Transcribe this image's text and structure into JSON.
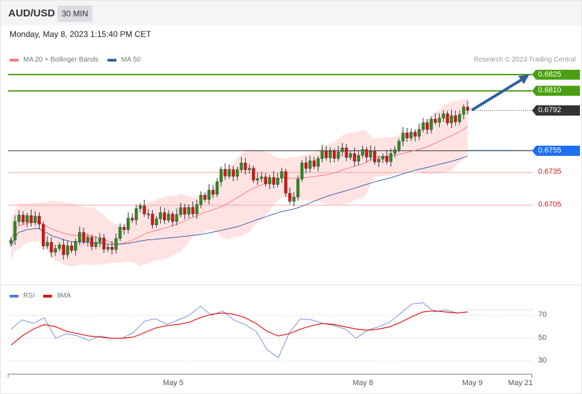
{
  "header": {
    "pair": "AUD/USD",
    "timeframe": "30 MIN",
    "datetime": "Monday, May 8, 2023 1:15:40 PM CET"
  },
  "legend": {
    "ma20": "MA 20 + Bollinger Bands",
    "ma50": "MA 50",
    "rsi": "RSI",
    "ma9": "9MA"
  },
  "credit": "Research © 2023 Trading Central",
  "colors": {
    "up": "#2e8b1e",
    "down": "#e01010",
    "ma20": "#ff7b7b",
    "ma50": "#3a5ea8",
    "band": "#ffe3e3",
    "target": "#4aa010",
    "pivot": "#1e6ef0",
    "current": "#333333",
    "support": "#e01010",
    "arrow": "#2f5f9e",
    "rsi": "#5577dd",
    "rsi9": "#e01010"
  },
  "chart_data": [
    {
      "type": "candlestick",
      "title": "AUD/USD 30 MIN",
      "ylim": [
        0.6648,
        0.6835
      ],
      "levels": [
        {
          "label": "0.6825",
          "value": 0.6825,
          "kind": "target"
        },
        {
          "label": "0.6810",
          "value": 0.681,
          "kind": "target"
        },
        {
          "label": "0.6792",
          "value": 0.6792,
          "kind": "current"
        },
        {
          "label": "0.6755",
          "value": 0.6755,
          "kind": "pivot"
        },
        {
          "label": "0.6735",
          "value": 0.6735,
          "kind": "support"
        },
        {
          "label": "0.6705",
          "value": 0.6705,
          "kind": "support"
        }
      ],
      "closes_keypoints": [
        0.6673,
        0.669,
        0.6695,
        0.667,
        0.6662,
        0.6675,
        0.667,
        0.6664,
        0.6685,
        0.6702,
        0.6692,
        0.6695,
        0.6702,
        0.672,
        0.6733,
        0.674,
        0.6726,
        0.6731,
        0.6706,
        0.6729,
        0.6739,
        0.675,
        0.6754,
        0.675,
        0.6752,
        0.6745,
        0.675,
        0.6761,
        0.6772,
        0.6777,
        0.6786,
        0.6783,
        0.6792
      ],
      "keypoint_positions": [
        0,
        1,
        6,
        8,
        13,
        17,
        22,
        24,
        28,
        31,
        35,
        40,
        45,
        50,
        52,
        58,
        62,
        67,
        69,
        71,
        72,
        77,
        81,
        84,
        89,
        92,
        94,
        95,
        99,
        103,
        105,
        108,
        113
      ],
      "candle_count": 114
    },
    {
      "type": "line",
      "title": "RSI",
      "ylim": [
        20,
        85
      ],
      "yticks": [
        "70",
        "50",
        "30"
      ],
      "series": [
        {
          "name": "RSI",
          "values": [
            58,
            66,
            63,
            68,
            50,
            54,
            52,
            48,
            52,
            50,
            50,
            55,
            65,
            67,
            62,
            66,
            70,
            78,
            70,
            74,
            66,
            62,
            56,
            40,
            33,
            55,
            67,
            66,
            63,
            61,
            58,
            50,
            57,
            60,
            64,
            72,
            80,
            81,
            73,
            75,
            72,
            73
          ]
        },
        {
          "name": "9MA",
          "values": [
            44,
            52,
            58,
            62,
            60,
            56,
            54,
            52,
            51,
            50,
            50,
            51,
            55,
            59,
            61,
            62,
            64,
            68,
            71,
            72,
            71,
            68,
            63,
            56,
            52,
            54,
            58,
            61,
            63,
            62,
            60,
            58,
            57,
            58,
            60,
            64,
            69,
            73,
            74,
            73,
            72,
            73
          ]
        }
      ],
      "xticks": [
        "May 5",
        "May 8",
        "May 9",
        "May 21"
      ]
    }
  ]
}
